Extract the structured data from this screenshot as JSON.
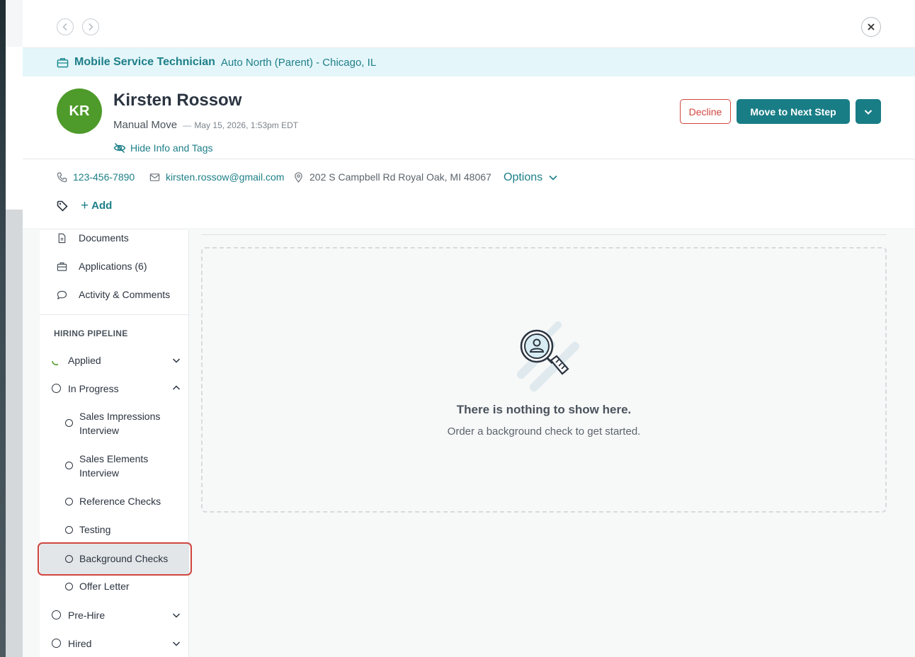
{
  "job": {
    "title": "Mobile Service Technician",
    "location": "Auto North (Parent) - Chicago, IL"
  },
  "candidate": {
    "initials": "KR",
    "name": "Kirsten Rossow",
    "source": "Manual Move",
    "separator": "—",
    "date": "May 15, 2026, 1:53pm EDT",
    "hide_info_label": "Hide Info and Tags",
    "avatar_color": "#4e9a2a"
  },
  "actions": {
    "decline_label": "Decline",
    "next_label": "Move to Next Step"
  },
  "contact": {
    "phone": "123-456-7890",
    "email": "kirsten.rossow@gmail.com",
    "address": "202 S Campbell Rd Royal Oak, MI 48067",
    "options_label": "Options",
    "add_tag_label": "Add"
  },
  "sidebar": {
    "nav": [
      {
        "label": "Documents",
        "icon": "document-icon"
      },
      {
        "label": "Applications (6)",
        "icon": "briefcase-icon"
      },
      {
        "label": "Activity & Comments",
        "icon": "comment-icon"
      }
    ],
    "pipeline_heading": "HIRING PIPELINE",
    "pipeline": {
      "applied": "Applied",
      "in_progress": "In Progress",
      "sales_impressions": "Sales Impressions Interview",
      "sales_elements": "Sales Elements Interview",
      "reference_checks": "Reference Checks",
      "testing": "Testing",
      "background_checks": "Background Checks",
      "offer_letter": "Offer Letter",
      "pre_hire": "Pre-Hire",
      "hired": "Hired"
    }
  },
  "empty_state": {
    "title": "There is nothing to show here.",
    "subtitle": "Order a background check to get started.",
    "icon": "magnifier-person-icon"
  },
  "colors": {
    "accent": "#197d86",
    "danger": "#d0463f",
    "banner_bg": "#e4f6fa"
  }
}
